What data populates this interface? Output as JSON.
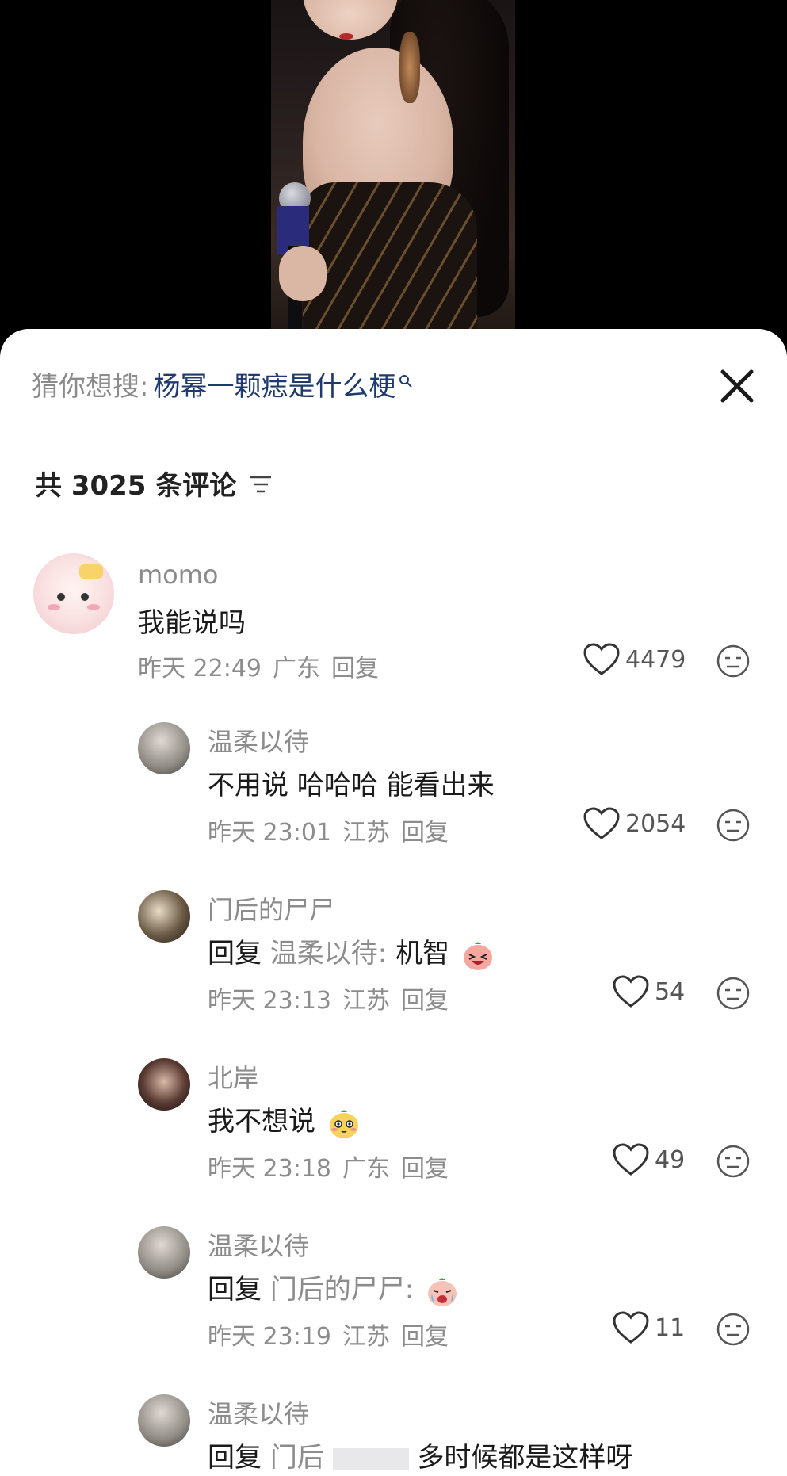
{
  "search_suggestion": {
    "prefix": "猜你想搜:",
    "query": "杨幂一颗痣是什么梗"
  },
  "comments_header": {
    "count_label": "共 3025 条评论"
  },
  "comments": [
    {
      "username": "momo",
      "text": "我能说吗",
      "time": "昨天 22:49",
      "location": "广东",
      "reply_label": "回复",
      "likes": "4479"
    }
  ],
  "replies": [
    {
      "username": "温柔以待",
      "text": "不用说 哈哈哈  能看出来",
      "time": "昨天 23:01",
      "location": "江苏",
      "reply_label": "回复",
      "likes": "2054"
    },
    {
      "username": "门后的尸尸",
      "reply_prefix": "回复",
      "reply_target": "温柔以待:",
      "text": "机智",
      "emoji": "laughing-emoji",
      "time": "昨天 23:13",
      "location": "江苏",
      "reply_label": "回复",
      "likes": "54"
    },
    {
      "username": "北岸",
      "text": "我不想说",
      "emoji": "shy-emoji",
      "time": "昨天 23:18",
      "location": "广东",
      "reply_label": "回复",
      "likes": "49"
    },
    {
      "username": "温柔以待",
      "reply_prefix": "回复",
      "reply_target": "门后的尸尸:",
      "emoji": "crying-emoji",
      "time": "昨天 23:19",
      "location": "江苏",
      "reply_label": "回复",
      "likes": "11"
    },
    {
      "username": "温柔以待",
      "reply_prefix": "回复",
      "reply_target": "门后",
      "text": "多时候都是这样呀"
    }
  ],
  "colors": {
    "sheet_bg": "#ffffff",
    "query_text": "#1f3a6e",
    "muted_text": "#8c8c8c"
  }
}
